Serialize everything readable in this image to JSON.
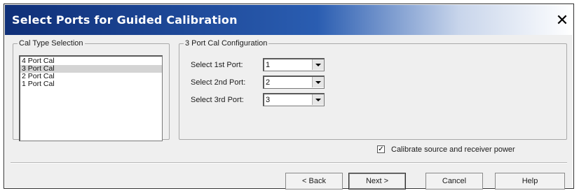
{
  "window": {
    "title": "Select Ports for Guided Calibration",
    "close_glyph": "✕"
  },
  "cal_type": {
    "legend": "Cal Type Selection",
    "items": [
      "4 Port Cal",
      "3 Port Cal",
      "2 Port Cal",
      "1 Port Cal"
    ],
    "selected": "3 Port Cal"
  },
  "config": {
    "legend": "3 Port Cal Configuration",
    "rows": [
      {
        "label": "Select 1st Port:",
        "value": "1"
      },
      {
        "label": "Select 2nd Port:",
        "value": "2"
      },
      {
        "label": "Select 3rd Port:",
        "value": "3"
      }
    ]
  },
  "calibrate_power": {
    "label": "Calibrate source and receiver power",
    "checked": true
  },
  "buttons": {
    "back": "< Back",
    "next": "Next >",
    "cancel": "Cancel",
    "help": "Help"
  },
  "colors": {
    "title_bar_start": "#0f2f78",
    "title_bar_end": "#ffffff",
    "dialog_bg": "#efefef",
    "selection": "#d4d4d4"
  }
}
